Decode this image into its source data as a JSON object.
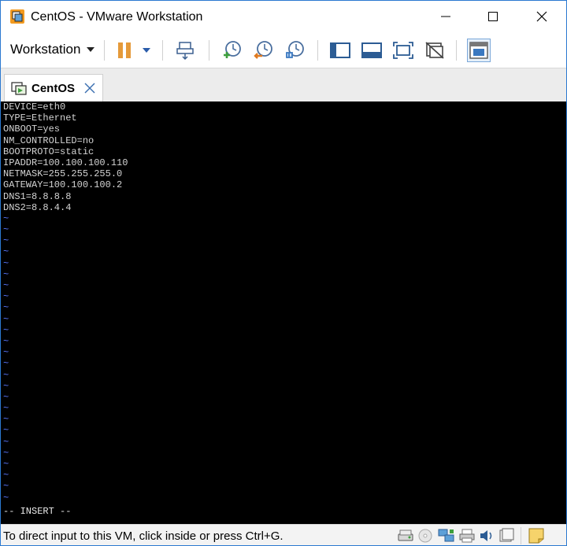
{
  "window": {
    "title": "CentOS - VMware Workstation"
  },
  "toolbar": {
    "menu_label": "Workstation",
    "buttons": [
      "pause-icon",
      "send-ctrl-alt-del-icon",
      "snapshot-take-icon",
      "snapshot-revert-icon",
      "snapshot-manager-icon",
      "show-library-icon",
      "show-thumbnail-bar-icon",
      "full-screen-icon",
      "unity-icon",
      "console-view-icon"
    ]
  },
  "tabs": [
    {
      "label": "CentOS",
      "active": true
    }
  ],
  "console": {
    "lines": [
      "DEVICE=eth0",
      "TYPE=Ethernet",
      "ONBOOT=yes",
      "NM_CONTROLLED=no",
      "BOOTPROTO=static",
      "IPADDR=100.100.100.110",
      "NETMASK=255.255.255.0",
      "GATEWAY=100.100.100.2",
      "DNS1=8.8.8.8",
      "DNS2=8.8.4.4"
    ],
    "tilde_char": "~",
    "tilde_count": 26,
    "mode_line": "-- INSERT --"
  },
  "statusbar": {
    "message": "To direct input to this VM, click inside or press Ctrl+G.",
    "devices": [
      "hard-disk-icon",
      "cd-dvd-icon",
      "network-adapter-icon",
      "printer-icon",
      "sound-card-icon",
      "display-icon",
      "message-log-icon"
    ]
  },
  "colors": {
    "terminal_bg": "#000000",
    "terminal_fg": "#d4d4d4",
    "vim_tilde": "#5a78ff",
    "accent": "#2b79d0"
  }
}
